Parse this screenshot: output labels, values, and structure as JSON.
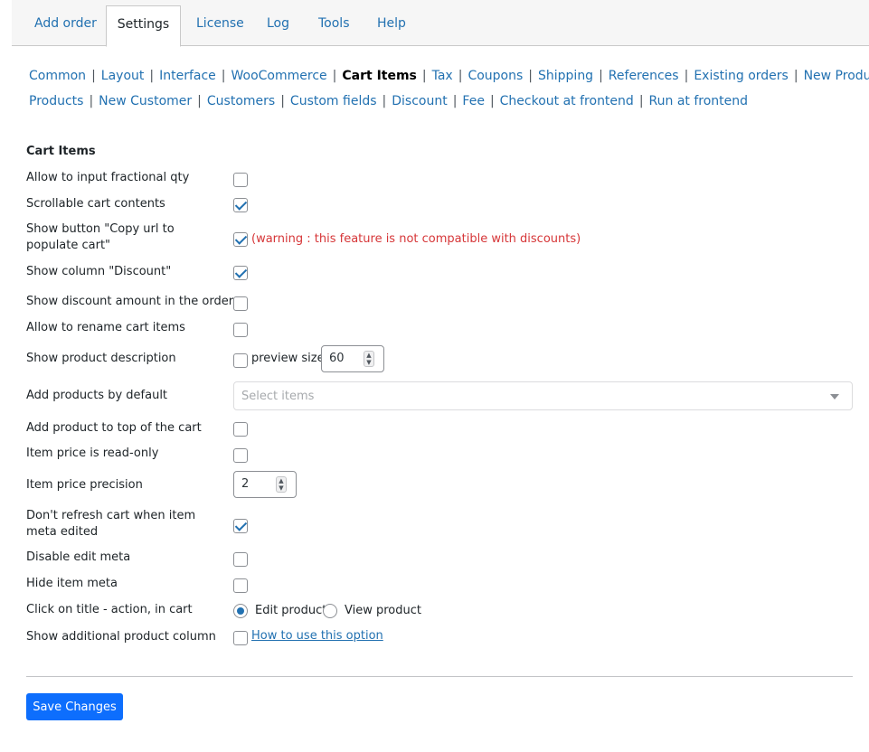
{
  "tabs": [
    {
      "label": "Add order",
      "active": false
    },
    {
      "label": "Settings",
      "active": true
    },
    {
      "label": "License",
      "active": false
    },
    {
      "label": "Log",
      "active": false
    },
    {
      "label": "Tools",
      "active": false
    },
    {
      "label": "Help",
      "active": false
    }
  ],
  "subnav": {
    "row1": [
      "Common",
      "Layout",
      "Interface",
      "WooCommerce",
      "Cart Items",
      "Tax",
      "Coupons",
      "Shipping",
      "References",
      "Existing orders",
      "New Product"
    ],
    "row2": [
      "Products",
      "New Customer",
      "Customers",
      "Custom fields",
      "Discount",
      "Fee",
      "Checkout at frontend",
      "Run at frontend"
    ],
    "current": "Cart Items",
    "separator": "|"
  },
  "section_title": "Cart Items",
  "settings": {
    "fractional_qty": {
      "label": "Allow to input fractional qty",
      "checked": false
    },
    "scrollable": {
      "label": "Scrollable cart contents",
      "checked": true
    },
    "copy_url": {
      "label": "Show button \"Copy url to populate cart\"",
      "checked": true,
      "warning": "(warning : this feature is not compatible with discounts)"
    },
    "discount_col": {
      "label": "Show column \"Discount\"",
      "checked": true
    },
    "discount_amount": {
      "label": "Show discount amount in the order",
      "checked": false
    },
    "rename_items": {
      "label": "Allow to rename cart items",
      "checked": false
    },
    "product_desc": {
      "label": "Show product description",
      "checked": false,
      "preview_label": "preview size",
      "preview_value": "60"
    },
    "add_default": {
      "label": "Add products by default",
      "placeholder": "Select items"
    },
    "add_top": {
      "label": "Add product to top of the cart",
      "checked": false
    },
    "price_readonly": {
      "label": "Item price is read-only",
      "checked": false
    },
    "price_precision": {
      "label": "Item price precision",
      "value": "2"
    },
    "no_refresh": {
      "label": "Don't refresh cart when item meta edited",
      "checked": true
    },
    "disable_meta": {
      "label": "Disable edit meta",
      "checked": false
    },
    "hide_meta": {
      "label": "Hide item meta",
      "checked": false
    },
    "click_title": {
      "label": "Click on title - action, in cart",
      "options": [
        "Edit product",
        "View product"
      ],
      "selected": "Edit product"
    },
    "additional_col": {
      "label": "Show additional product column",
      "checked": false,
      "link": "How to use this option"
    }
  },
  "save_label": "Save Changes",
  "colors": {
    "accent": "#2271b1",
    "button": "#0d6efd",
    "warning": "#d63638"
  }
}
